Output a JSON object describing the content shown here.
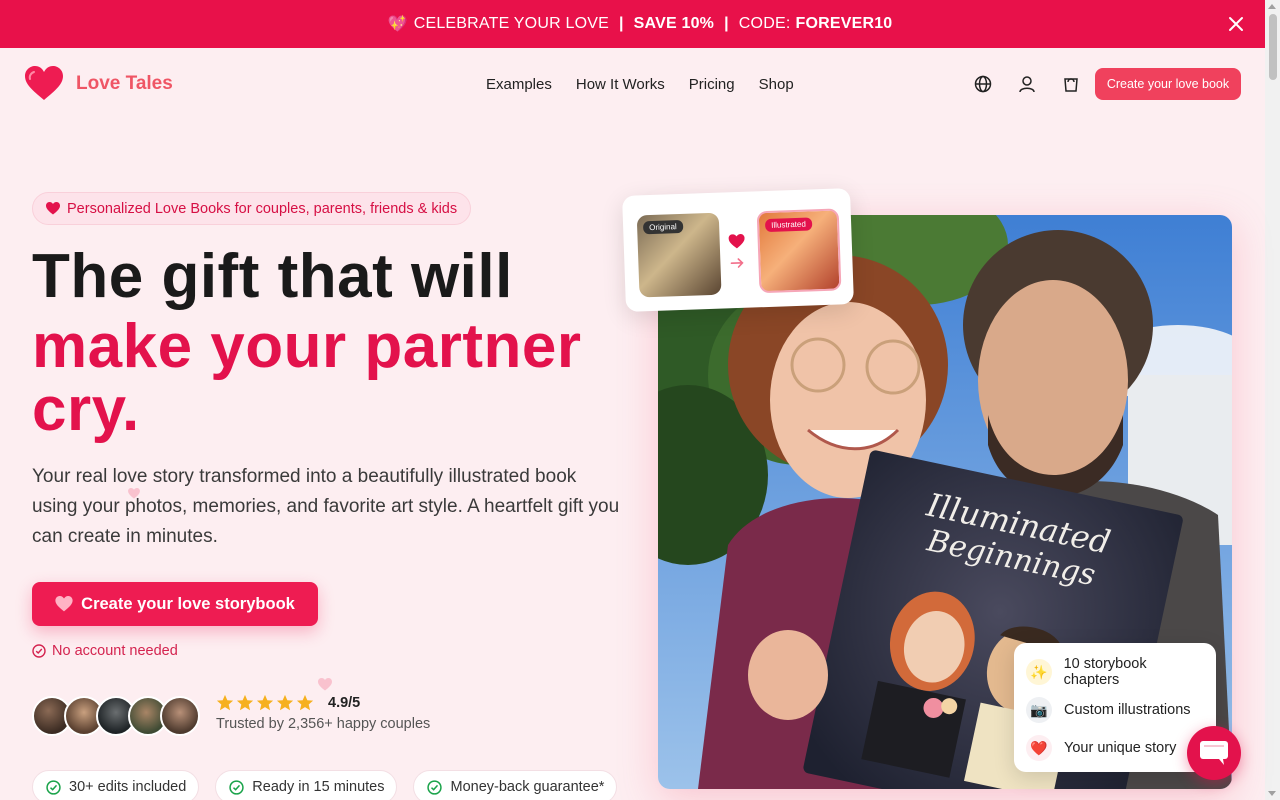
{
  "promo": {
    "emoji": "💖",
    "text": "CELEBRATE YOUR LOVE",
    "sep": "|",
    "save": "SAVE 10%",
    "code_label": "CODE:",
    "code": "FOREVER10"
  },
  "nav": {
    "brand": "Love Tales",
    "items": [
      "Examples",
      "How It Works",
      "Pricing",
      "Shop"
    ],
    "cta": "Create your love book"
  },
  "hero": {
    "pill": "Personalized Love Books for couples, parents, friends & kids",
    "headline_1": "The gift that will",
    "headline_2": "make your partner",
    "headline_3": "cry.",
    "lead": "Your real love story transformed into a beautifully illustrated book using your photos, memories, and favorite art style. A heartfelt gift you can create in minutes.",
    "cta": "Create your love storybook",
    "no_account": "No account needed",
    "rating": "4.9/5",
    "rating_stars": 5,
    "trusted": "Trusted by 2,356+ happy couples",
    "badges": [
      "30+ edits included",
      "Ready in 15 minutes",
      "Money-back guarantee*"
    ]
  },
  "compare": {
    "original_tag": "Original",
    "illustrated_tag": "Illustrated"
  },
  "book": {
    "title_1": "Illuminated",
    "title_2": "Beginnings"
  },
  "features": [
    {
      "icon": "✨",
      "label": "10 storybook chapters"
    },
    {
      "icon": "📷",
      "label": "Custom illustrations"
    },
    {
      "icon": "❤️",
      "label": "Your unique story"
    }
  ],
  "colors": {
    "brand": "#e3124c",
    "accent": "#f0415d",
    "background": "#fdeef1"
  }
}
